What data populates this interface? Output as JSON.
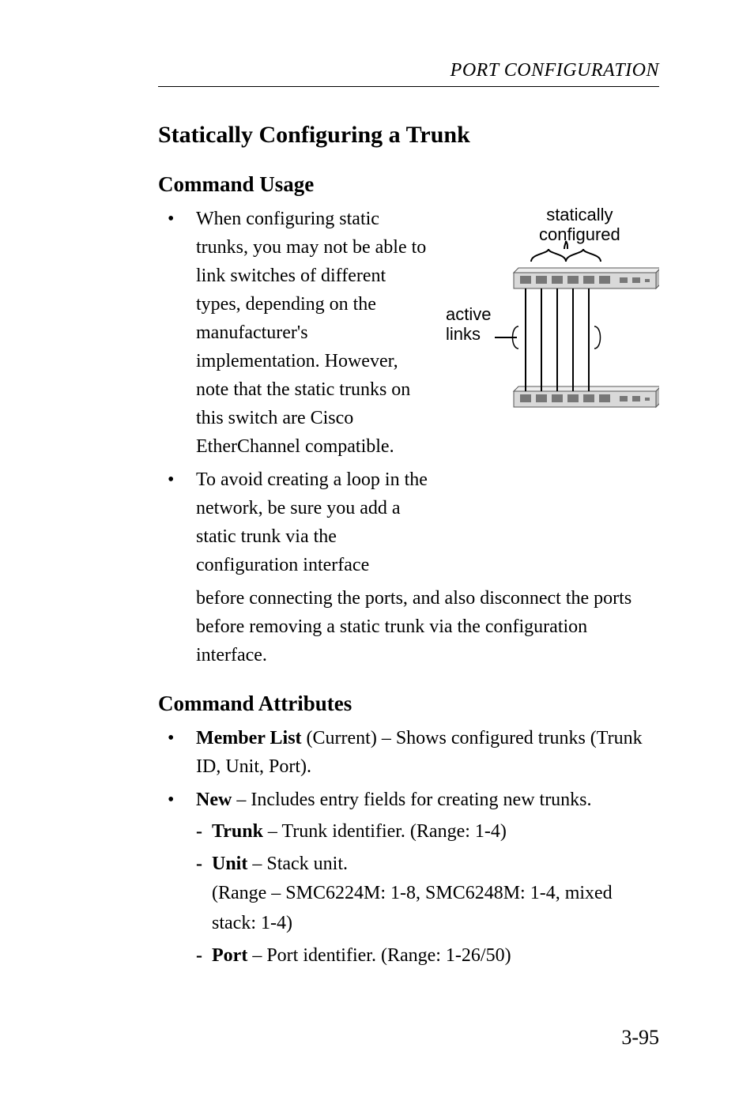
{
  "running_head": "PORT CONFIGURATION",
  "section_title": "Statically Configuring a Trunk",
  "usage_heading": "Command Usage",
  "usage_items": [
    "When configuring static trunks, you may not be able to link switches of different types, depending on the manufacturer's implementation. However, note that the static trunks on this switch are Cisco EtherChannel compatible.",
    "To avoid creating a loop in the network, be sure you add a static trunk via the configuration interface"
  ],
  "usage_continuation": "before connecting the ports, and also disconnect the ports before removing a static trunk via the configuration interface.",
  "attributes_heading": "Command Attributes",
  "attr_member_label": "Member List",
  "attr_member_rest": " (Current) – Shows configured trunks (Trunk ID, Unit, Port).",
  "attr_new_label": "New",
  "attr_new_rest": " – Includes entry fields for creating new trunks.",
  "sub_trunk_label": "Trunk",
  "sub_trunk_rest": " – Trunk identifier. (Range: 1-4)",
  "sub_unit_label": "Unit",
  "sub_unit_rest": " – Stack unit.",
  "sub_unit_line2": " (Range – SMC6224M: 1-8, SMC6248M: 1-4, mixed stack: 1-4)",
  "sub_port_label": "Port",
  "sub_port_rest": " – Port identifier. (Range: 1-26/50)",
  "diagram": {
    "top_line1": "statically",
    "top_line2": "configured",
    "side_line1": "active",
    "side_line2": "links"
  },
  "page_number": "3-95"
}
